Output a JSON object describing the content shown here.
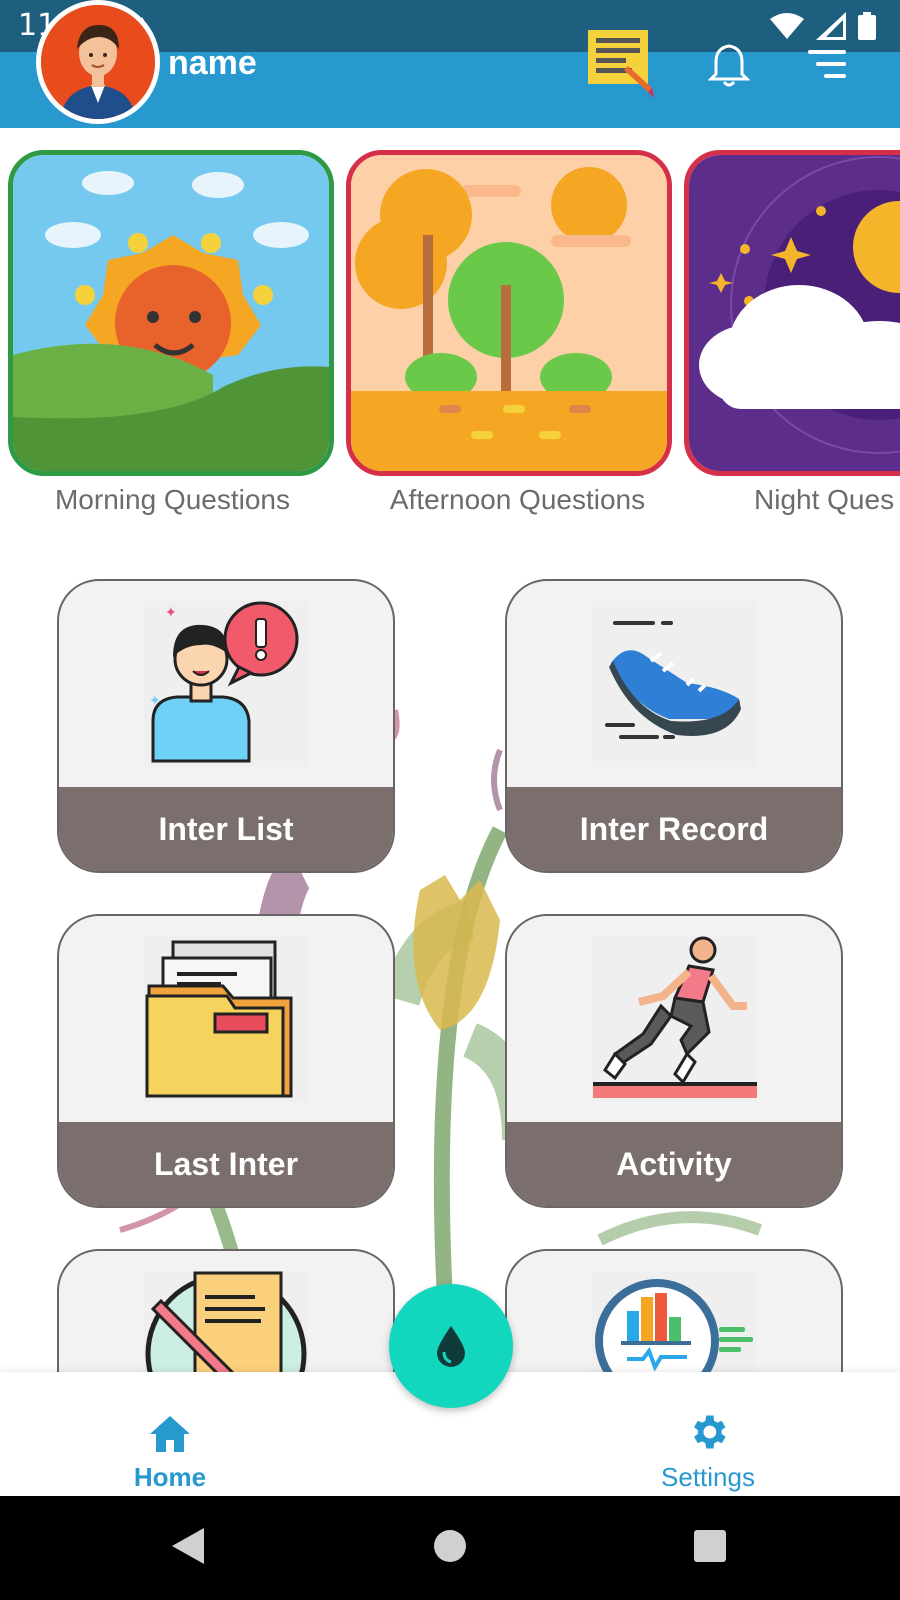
{
  "status_bar": {
    "time": "11:17"
  },
  "header": {
    "user_name": "name"
  },
  "time_tiles": [
    {
      "label": "Morning Questions",
      "border": "#2e9a44"
    },
    {
      "label": "Afternoon Questions",
      "border": "#d63049"
    },
    {
      "label": "Night Ques",
      "border": "#d63049"
    }
  ],
  "cards": [
    {
      "label": "Inter List"
    },
    {
      "label": "Inter Record"
    },
    {
      "label": "Last Inter"
    },
    {
      "label": "Activity"
    }
  ],
  "bottom_nav": {
    "home_label": "Home",
    "settings_label": "Settings",
    "fab_icon": "water-drop-icon"
  },
  "colors": {
    "appbar": "#2899cf",
    "statusbar": "#1e5f80",
    "card_band": "#7a6f6d",
    "fab": "#13d6be",
    "nav_active": "#2899cf"
  }
}
